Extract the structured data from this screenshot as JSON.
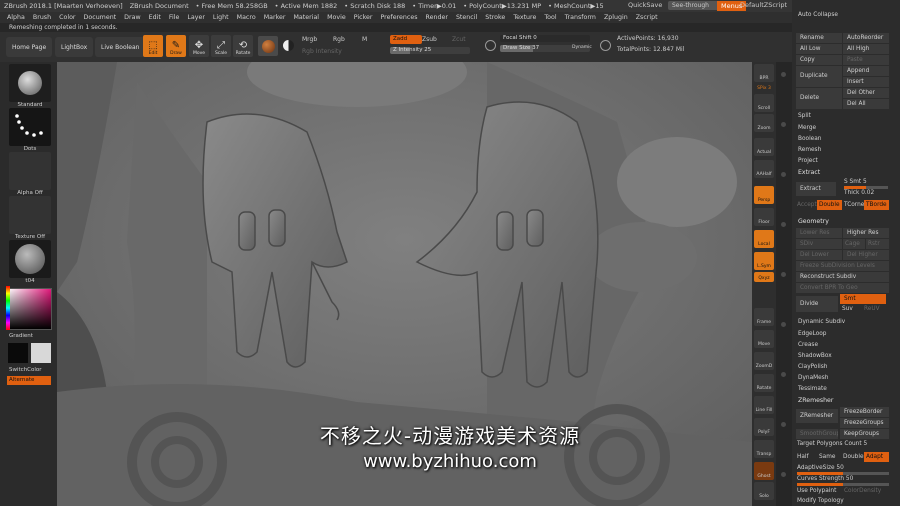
{
  "titlebar": {
    "app": "ZBrush 2018.1 [Maarten Verhoeven]",
    "doc": "ZBrush Document",
    "free_mem": "• Free Mem 58.258GB",
    "active_mem": "• Active Mem 1882",
    "scratch": "• Scratch Disk 188",
    "timer": "• Timer▶0.01",
    "polycount": "• PolyCount▶13.231 MP",
    "meshcount": "• MeshCount▶15",
    "quicksave": "QuickSave",
    "see_through": "See-through",
    "see_through_value": "0",
    "menus": "Menus",
    "default_script": "DefaultZScript"
  },
  "menubar": [
    "Alpha",
    "Brush",
    "Color",
    "Document",
    "Draw",
    "Edit",
    "File",
    "Layer",
    "Light",
    "Macro",
    "Marker",
    "Material",
    "Movie",
    "Picker",
    "Preferences",
    "Render",
    "Stencil",
    "Stroke",
    "Texture",
    "Tool",
    "Transform",
    "Zplugin",
    "Zscript"
  ],
  "status": "Remeshing completed in 1 seconds.",
  "toolbar": {
    "home_page": "Home Page",
    "lightbox": "LightBox",
    "live_boolean": "Live Boolean",
    "edit": "Edit",
    "draw": "Draw",
    "move": "Move",
    "scale": "Scale",
    "rotate": "Rotate",
    "mrgb": "Mrgb",
    "rgb": "Rgb",
    "m": "M",
    "rgb_intensity": "Rgb Intensity",
    "zadd": "Zadd",
    "zsub": "Zsub",
    "zcut": "Zcut",
    "z_intensity": "Z Intensity",
    "z_intensity_value": "25",
    "focal_shift": "Focal Shift",
    "focal_shift_value": "0",
    "draw_size": "Draw Size",
    "draw_size_value": "37",
    "dynamic": "Dynamic",
    "active_points": "ActivePoints: 16,930",
    "total_points": "TotalPoints: 12.847 Mil"
  },
  "left": {
    "brush": "Standard",
    "stroke": "Dots",
    "alpha": "Alpha Off",
    "texture": "Texture Off",
    "material": "t04",
    "gradient": "Gradient",
    "switch_color": "SwitchColor",
    "alternate": "Alternate"
  },
  "shelf": [
    "BPR",
    "SPix 3",
    "Scroll",
    "Zoom",
    "Actual",
    "AAHalf",
    "Persp",
    "Floor",
    "Local",
    "L.Sym",
    "Qxyz",
    "Frame",
    "Move",
    "ZoomD",
    "Rotate",
    "Line Fill",
    "PolyF",
    "Transp",
    "Ghost",
    "Solo",
    "Xpose"
  ],
  "right": {
    "auto_collapse": "Auto Collapse",
    "rename": "Rename",
    "autoreorder": "AutoReorder",
    "all_low": "All Low",
    "all_high": "All High",
    "copy": "Copy",
    "paste": "Paste",
    "duplicate": "Duplicate",
    "append": "Append",
    "insert": "Insert",
    "delete": "Delete",
    "del_other": "Del Other",
    "del_all": "Del All",
    "split": "Split",
    "merge": "Merge",
    "boolean": "Boolean",
    "remesh": "Remesh",
    "project": "Project",
    "extract_head": "Extract",
    "extract": "Extract",
    "s_smt": "S Smt",
    "s_smt_value": "5",
    "thick": "Thick",
    "thick_value": "0.02",
    "accept": "Accept",
    "double": "Double",
    "tcorne": "TCorne",
    "tborde": "TBorde",
    "geometry_head": "Geometry",
    "lower_res": "Lower Res",
    "higher_res": "Higher Res",
    "sdiv": "SDiv",
    "cage": "Cage",
    "rstr": "Rstr",
    "del_lower": "Del Lower",
    "del_higher": "Del Higher",
    "freeze_subdiv": "Freeze SubDivision Levels",
    "reconstruct_subdiv": "Reconstruct Subdiv",
    "convert_bpr": "Convert BPR To Geo",
    "divide": "Divide",
    "smt": "Smt",
    "suv": "Suv",
    "reuv": "ReUV",
    "dynamic_subdiv": "Dynamic Subdiv",
    "edgeloop": "EdgeLoop",
    "crease": "Crease",
    "shadowbox": "ShadowBox",
    "claypolish": "ClayPolish",
    "dynamesh": "DynaMesh",
    "tessimate": "Tessimate",
    "zremesher_head": "ZRemesher",
    "zremesher": "ZRemesher",
    "freeze_border": "FreezeBorder",
    "freeze_groups": "FreezeGroups",
    "smooth_groups": "SmoothGroups",
    "keep_groups": "KeepGroups",
    "target_polygons": "Target Polygons Count",
    "target_polygons_value": "5",
    "half": "Half",
    "same": "Same",
    "double2": "Double",
    "adapt": "Adapt",
    "adaptive_size": "AdaptiveSize",
    "adaptive_size_value": "50",
    "curves_strength": "Curves Strength",
    "curves_strength_value": "50",
    "use_polypaint": "Use Polypaint",
    "color_density": "ColorDensity",
    "modify_topology": "Modify Topology"
  },
  "watermark": {
    "line1": "不移之火-动漫游戏美术资源",
    "line2": "www.byzhihuo.com"
  },
  "colors": {
    "accent": "#e06010",
    "panel": "#2c2c2c",
    "viewport": "#707070"
  }
}
